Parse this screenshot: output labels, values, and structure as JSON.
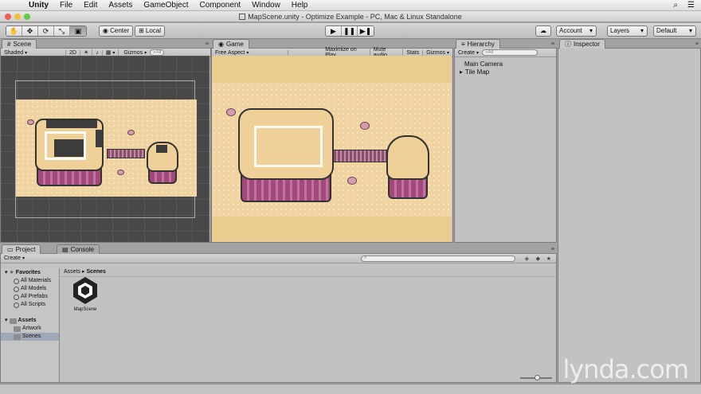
{
  "menubar": {
    "app_name": "Unity",
    "items": [
      "File",
      "Edit",
      "Assets",
      "GameObject",
      "Component",
      "Window",
      "Help"
    ]
  },
  "window": {
    "title": "MapScene.unity - Optimize Example - PC, Mac & Linux Standalone"
  },
  "toolbar": {
    "pivot_label": "Center",
    "space_label": "Local",
    "account_label": "Account",
    "layers_label": "Layers",
    "layout_label": "Default",
    "active_tool_index": 4
  },
  "scene": {
    "tab_label": "Scene",
    "shading_mode": "Shaded",
    "mode_2d": "2D",
    "gizmos_label": "Gizmos",
    "search_placeholder": "All"
  },
  "game": {
    "tab_label": "Game",
    "aspect": "Free Aspect",
    "maximize_label": "Maximize on Play",
    "mute_label": "Mute audio",
    "stats_label": "Stats",
    "gizmos_label": "Gizmos"
  },
  "hierarchy": {
    "tab_label": "Hierarchy",
    "create_label": "Create",
    "search_placeholder": "All",
    "items": [
      "Main Camera",
      "Tile Map"
    ]
  },
  "inspector": {
    "tab_label": "Inspector"
  },
  "project": {
    "tab_label": "Project",
    "console_tab_label": "Console",
    "create_label": "Create",
    "favorites_label": "Favorites",
    "favorites": [
      "All Materials",
      "All Models",
      "All Prefabs",
      "All Scripts"
    ],
    "assets_label": "Assets",
    "asset_folders": [
      "Artwork",
      "Scenes"
    ],
    "selected_folder": "Scenes",
    "breadcrumb_root": "Assets",
    "breadcrumb_current": "Scenes",
    "files": [
      "MapScene"
    ]
  },
  "watermark": "lynda.com"
}
